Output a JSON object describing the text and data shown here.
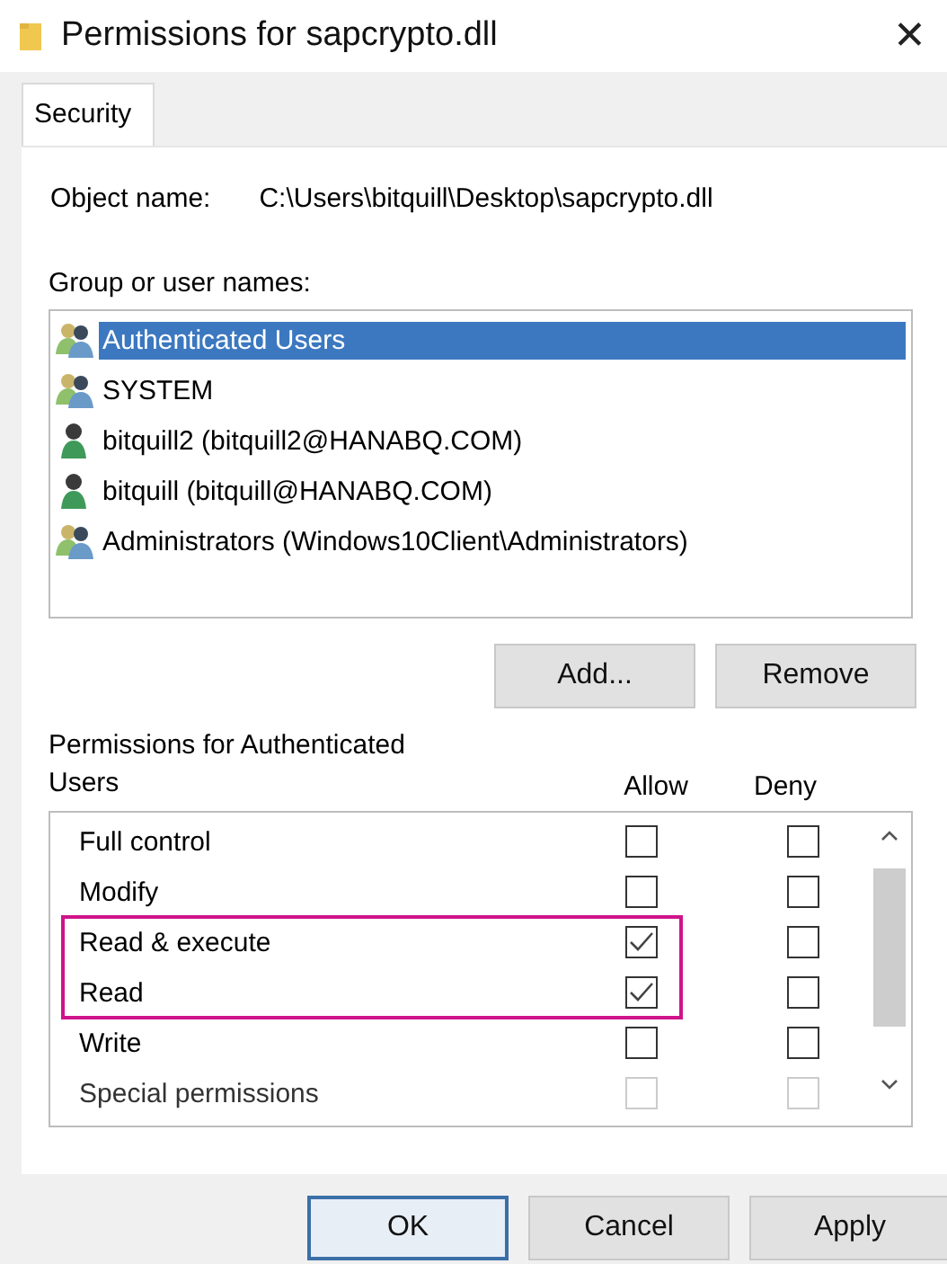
{
  "window": {
    "title": "Permissions for sapcrypto.dll",
    "close": "✕"
  },
  "tabs": [
    {
      "label": "Security",
      "selected": true
    }
  ],
  "object_name": {
    "label": "Object name:",
    "value": "C:\\Users\\bitquill\\Desktop\\sapcrypto.dll"
  },
  "groups": {
    "label": "Group or user names:",
    "items": [
      {
        "name": "Authenticated Users",
        "kind": "group",
        "selected": true
      },
      {
        "name": "SYSTEM",
        "kind": "group",
        "selected": false
      },
      {
        "name": "bitquill2 (bitquill2@HANABQ.COM)",
        "kind": "user",
        "selected": false
      },
      {
        "name": "bitquill (bitquill@HANABQ.COM)",
        "kind": "user",
        "selected": false
      },
      {
        "name": "Administrators (Windows10Client\\Administrators)",
        "kind": "group",
        "selected": false
      }
    ]
  },
  "group_buttons": [
    "Add...",
    "Remove"
  ],
  "permissions": {
    "label": "Permissions for Authenticated Users",
    "allow_header": "Allow",
    "deny_header": "Deny",
    "rows": [
      {
        "name": "Full control",
        "allow": false,
        "deny": false,
        "highlighted": false,
        "disabled": false
      },
      {
        "name": "Modify",
        "allow": false,
        "deny": false,
        "highlighted": false,
        "disabled": false
      },
      {
        "name": "Read & execute",
        "allow": true,
        "deny": false,
        "highlighted": true,
        "disabled": false
      },
      {
        "name": "Read",
        "allow": true,
        "deny": false,
        "highlighted": true,
        "disabled": false
      },
      {
        "name": "Write",
        "allow": false,
        "deny": false,
        "highlighted": false,
        "disabled": false
      },
      {
        "name": "Special permissions",
        "allow": false,
        "deny": false,
        "highlighted": false,
        "disabled": true
      }
    ]
  },
  "buttons": [
    {
      "label": "OK",
      "default": true
    },
    {
      "label": "Cancel",
      "default": false
    },
    {
      "label": "Apply",
      "default": false
    }
  ]
}
